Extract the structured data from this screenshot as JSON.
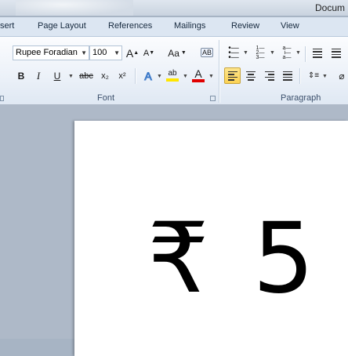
{
  "window": {
    "title": "Docum"
  },
  "tabs": [
    {
      "label": "sert"
    },
    {
      "label": "Page Layout"
    },
    {
      "label": "References"
    },
    {
      "label": "Mailings"
    },
    {
      "label": "Review"
    },
    {
      "label": "View"
    }
  ],
  "font_group": {
    "label": "Font",
    "font_name": "Rupee Foradian",
    "font_size": "100",
    "grow_label": "A",
    "shrink_label": "A",
    "case_label": "Aa",
    "bold": "B",
    "italic": "I",
    "underline": "U",
    "strike": "abc",
    "subscript": "x₂",
    "superscript": "x²",
    "effects": "A",
    "highlight": "ab",
    "font_color": "A",
    "highlight_color": "#ffe600",
    "font_color_value": "#e00000"
  },
  "paragraph_group": {
    "label": "Paragraph",
    "alignment": "left"
  },
  "document": {
    "content": "₹ 5"
  }
}
